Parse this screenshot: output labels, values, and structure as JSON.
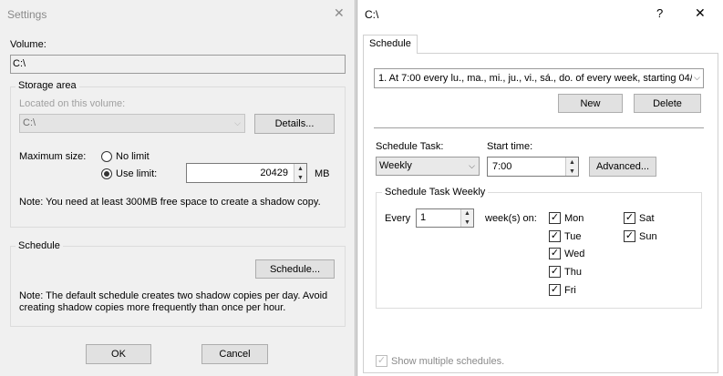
{
  "settings": {
    "title": "Settings",
    "close_glyph": "✕",
    "volume_label": "Volume:",
    "volume_value": "C:\\",
    "storage_group": "Storage area",
    "located_label": "Located on this volume:",
    "located_value": "C:\\",
    "details_button": "Details...",
    "max_size_label": "Maximum size:",
    "no_limit_label": "No limit",
    "use_limit_label": "Use limit:",
    "limit_value": "20429",
    "limit_unit": "MB",
    "note_space": "Note: You need at least 300MB free space to create a shadow copy.",
    "schedule_group": "Schedule",
    "schedule_button": "Schedule...",
    "note_schedule_1": "Note: The default schedule creates two shadow copies per day. Avoid",
    "note_schedule_2": "creating shadow copies more frequently than once per hour.",
    "ok_button": "OK",
    "cancel_button": "Cancel"
  },
  "schedule_dialog": {
    "title": "C:\\",
    "help_glyph": "?",
    "close_glyph": "✕",
    "tab_label": "Schedule",
    "schedule_list_value": "1. At 7:00 every lu., ma., mi., ju., vi., sá., do. of every week, starting 04/",
    "new_button": "New",
    "delete_button": "Delete",
    "task_label": "Schedule Task:",
    "task_value": "Weekly",
    "start_label": "Start time:",
    "start_value": "7:00",
    "advanced_button": "Advanced...",
    "weekly_group": "Schedule Task Weekly",
    "every_label": "Every",
    "every_value": "1",
    "weeks_on_label": "week(s) on:",
    "days": [
      {
        "label": "Mon",
        "checked": true
      },
      {
        "label": "Tue",
        "checked": true
      },
      {
        "label": "Wed",
        "checked": true
      },
      {
        "label": "Thu",
        "checked": true
      },
      {
        "label": "Fri",
        "checked": true
      },
      {
        "label": "Sat",
        "checked": true
      },
      {
        "label": "Sun",
        "checked": true
      }
    ],
    "check_glyph": "✓",
    "show_multiple_label": "Show multiple schedules."
  }
}
